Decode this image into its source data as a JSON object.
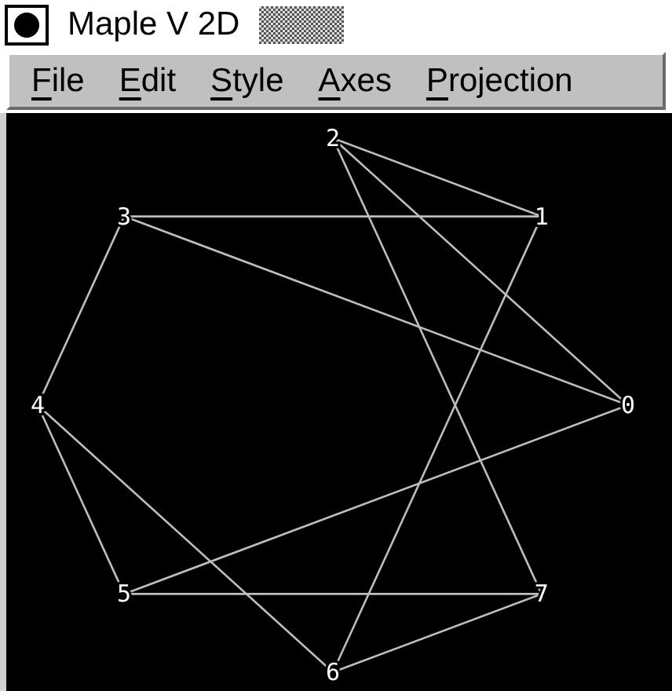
{
  "window": {
    "title": "Maple V 2D"
  },
  "menu": [
    {
      "label": "File"
    },
    {
      "label": "Edit"
    },
    {
      "label": "Style"
    },
    {
      "label": "Axes"
    },
    {
      "label": "Projection"
    }
  ],
  "graph": {
    "nodes": [
      {
        "label": "0"
      },
      {
        "label": "1"
      },
      {
        "label": "2"
      },
      {
        "label": "3"
      },
      {
        "label": "4"
      },
      {
        "label": "5"
      },
      {
        "label": "6"
      },
      {
        "label": "7"
      }
    ]
  }
}
